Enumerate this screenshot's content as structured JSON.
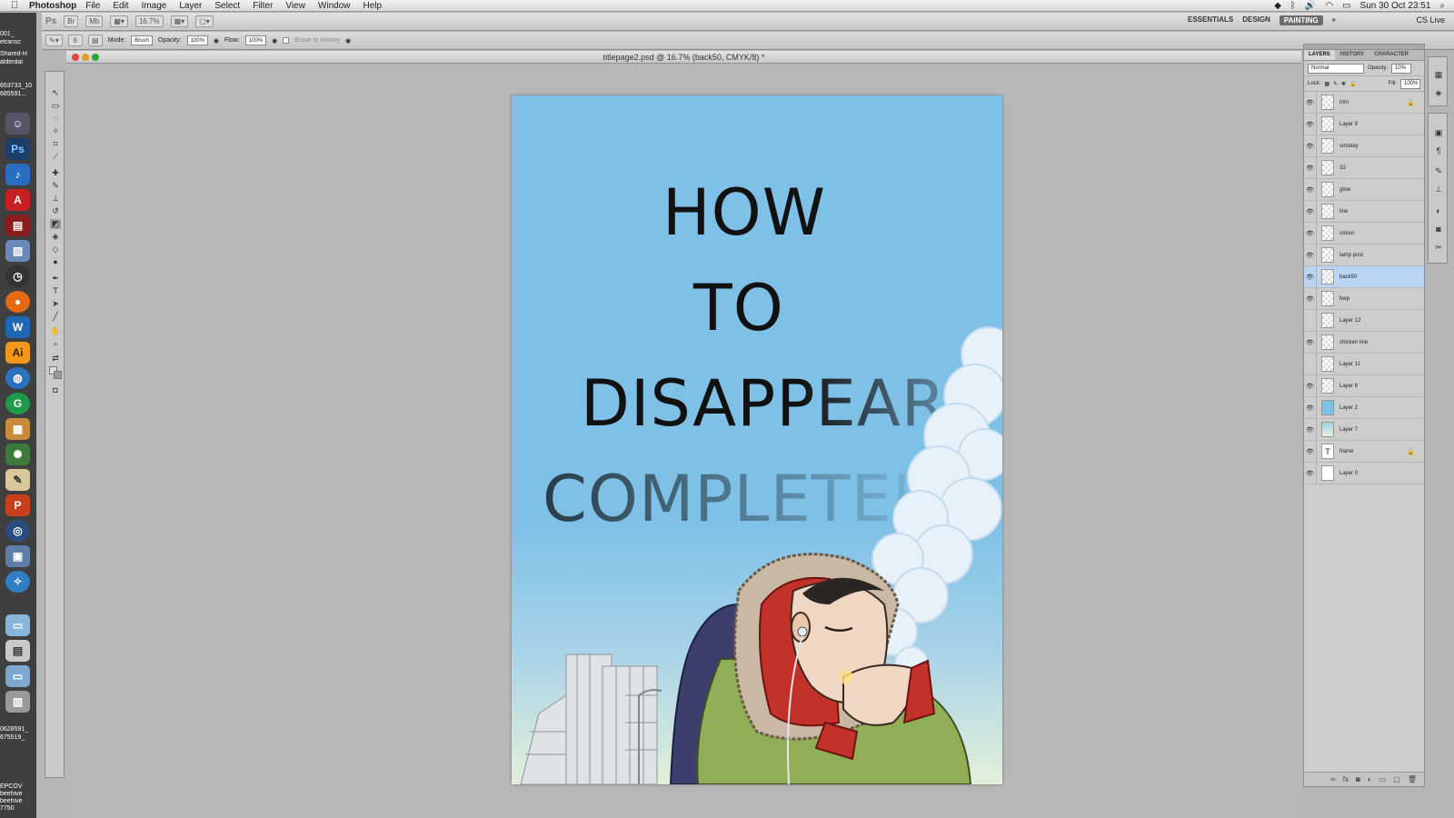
{
  "menubar": {
    "app": "Photoshop",
    "menus": [
      "File",
      "Edit",
      "Image",
      "Layer",
      "Select",
      "Filter",
      "View",
      "Window",
      "Help"
    ],
    "clock": "Sun 30 Oct  23:51"
  },
  "appbar": {
    "ps": "Ps",
    "zoom": "16.7%",
    "workspaces": [
      "ESSENTIALS",
      "DESIGN",
      "PAINTING"
    ],
    "active_workspace": "PAINTING",
    "more": "»",
    "cslive": "CS Live"
  },
  "options": {
    "brush_size": "6",
    "mode_label": "Mode:",
    "mode_value": "Brush",
    "opacity_label": "Opacity:",
    "opacity_value": "100%",
    "flow_label": "Flow:",
    "flow_value": "100%",
    "erase_label": "Erase to History"
  },
  "document": {
    "title": "titlepage2.psd @ 16.7% (back50, CMYK/8) *"
  },
  "artwork": {
    "lines": [
      "HOW",
      "TO",
      "DISAPPEAR",
      "COMPLETELY"
    ]
  },
  "desktop_labels": {
    "top": [
      "001_",
      "etransc",
      "Shared-H",
      "alderdal",
      "653733_10",
      "685591..."
    ],
    "bottom": [
      "0628591_",
      "675519_",
      "EPCOV",
      "beehive",
      "beehive",
      "7750"
    ]
  },
  "layers_panel": {
    "tabs": [
      "LAYERS",
      "HISTORY",
      "CHARACTER"
    ],
    "blend_mode": "Normal",
    "opacity_label": "Opacity:",
    "opacity_value": "10%",
    "lock_label": "Lock:",
    "fill_label": "Fill:",
    "fill_value": "100%",
    "layers": [
      {
        "name": "trim",
        "visible": true,
        "locked": true
      },
      {
        "name": "Layer 9",
        "visible": true,
        "locked": false
      },
      {
        "name": "smokey",
        "visible": true,
        "locked": false
      },
      {
        "name": "33",
        "visible": true,
        "locked": false
      },
      {
        "name": "glow",
        "visible": true,
        "locked": false
      },
      {
        "name": "line",
        "visible": true,
        "locked": false
      },
      {
        "name": "colour",
        "visible": true,
        "locked": false
      },
      {
        "name": "lamp post",
        "visible": true,
        "locked": false
      },
      {
        "name": "back50",
        "visible": true,
        "locked": false,
        "selected": true
      },
      {
        "name": "bwp",
        "visible": true,
        "locked": false
      },
      {
        "name": "Layer 12",
        "visible": false,
        "locked": false
      },
      {
        "name": "chicken line",
        "visible": true,
        "locked": false
      },
      {
        "name": "Layer 11",
        "visible": false,
        "locked": false
      },
      {
        "name": "Layer 8",
        "visible": true,
        "locked": false
      },
      {
        "name": "Layer 2",
        "visible": true,
        "locked": false
      },
      {
        "name": "Layer 7",
        "visible": true,
        "locked": false
      },
      {
        "name": "frame",
        "visible": true,
        "locked": true,
        "type": "text"
      },
      {
        "name": "Layer 0",
        "visible": true,
        "locked": false
      }
    ]
  },
  "colors": {
    "sky": "#7ec0e6",
    "selection": "#b9d4f4"
  }
}
